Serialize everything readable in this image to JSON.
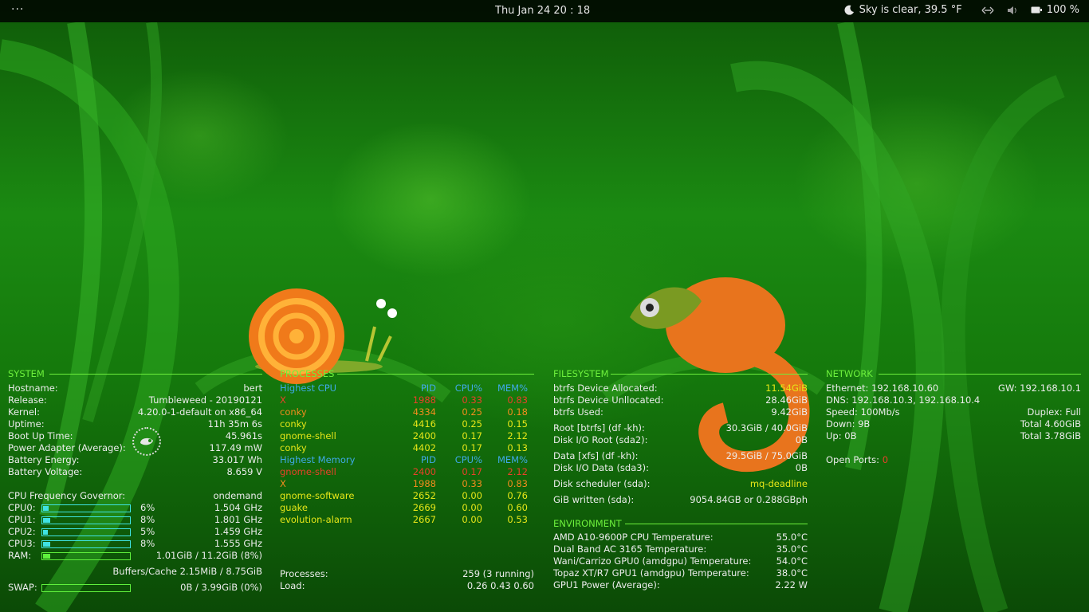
{
  "topbar": {
    "activities": "···",
    "clock": "Thu Jan 24  20 : 18",
    "weather": "Sky is clear, 39.5 °F",
    "battery": "100 %",
    "icons": [
      "moon-icon",
      "network-icon",
      "volume-icon",
      "battery-icon"
    ]
  },
  "system": {
    "title": "SYSTEM",
    "rows": [
      {
        "label": "Hostname:",
        "value": "bert"
      },
      {
        "label": "Release:",
        "value": "Tumbleweed - 20190121"
      },
      {
        "label": "Kernel:",
        "value": "4.20.0-1-default on x86_64"
      },
      {
        "label": "Uptime:",
        "value": "11h 35m 6s"
      },
      {
        "label": "Boot Up Time:",
        "value": "45.961s"
      },
      {
        "label": "Power Adapter (Average):",
        "value": "117.49 mW"
      },
      {
        "label": "Battery Energy:",
        "value": "33.017 Wh"
      },
      {
        "label": "Battery Voltage:",
        "value": "8.659 V"
      }
    ],
    "governor_label": "CPU Frequency Governor:",
    "governor_value": "ondemand",
    "cpus": [
      {
        "label": "CPU0:",
        "pct": "6%",
        "level": 0.06,
        "freq": "1.504 GHz"
      },
      {
        "label": "CPU1:",
        "pct": "8%",
        "level": 0.08,
        "freq": "1.801 GHz"
      },
      {
        "label": "CPU2:",
        "pct": "5%",
        "level": 0.05,
        "freq": "1.459 GHz"
      },
      {
        "label": "CPU3:",
        "pct": "8%",
        "level": 0.08,
        "freq": "1.555 GHz"
      }
    ],
    "ram_label": "RAM:",
    "ram_value": "1.01GiB / 11.2GiB (8%)",
    "ram_level": 0.08,
    "buffers": "Buffers/Cache 2.15MiB / 8.75GiB",
    "swap_label": "SWAP:",
    "swap_value": "0B   / 3.99GiB (0%)",
    "swap_level": 0
  },
  "processes": {
    "title": "PROCESSES",
    "cpu_header": {
      "name": "Highest CPU",
      "pid": "PID",
      "cpu": "CPU%",
      "mem": "MEM%"
    },
    "cpu_rows": [
      {
        "name": "X",
        "pid": "1988",
        "cpu": "0.33",
        "mem": "0.83"
      },
      {
        "name": "conky",
        "pid": "4334",
        "cpu": "0.25",
        "mem": "0.18"
      },
      {
        "name": "conky",
        "pid": "4416",
        "cpu": "0.25",
        "mem": "0.15"
      },
      {
        "name": "gnome-shell",
        "pid": "2400",
        "cpu": "0.17",
        "mem": "2.12"
      },
      {
        "name": "conky",
        "pid": "4402",
        "cpu": "0.17",
        "mem": "0.13"
      }
    ],
    "mem_header": {
      "name": "Highest Memory",
      "pid": "PID",
      "cpu": "CPU%",
      "mem": "MEM%"
    },
    "mem_rows": [
      {
        "name": "gnome-shell",
        "pid": "2400",
        "cpu": "0.17",
        "mem": "2.12"
      },
      {
        "name": "X",
        "pid": "1988",
        "cpu": "0.33",
        "mem": "0.83"
      },
      {
        "name": "gnome-software",
        "pid": "2652",
        "cpu": "0.00",
        "mem": "0.76"
      },
      {
        "name": "guake",
        "pid": "2669",
        "cpu": "0.00",
        "mem": "0.60"
      },
      {
        "name": "evolution-alarm",
        "pid": "2667",
        "cpu": "0.00",
        "mem": "0.53"
      }
    ],
    "processes_label": "Processes:",
    "processes_value": "259 (3 running)",
    "load_label": "Load:",
    "load_value": "0.26 0.43 0.60"
  },
  "filesystem": {
    "title": "FILESYSTEM",
    "allocated_label": "btrfs Device Allocated:",
    "allocated_value": "11.54GiB",
    "unallocated_label": "btrfs Device Unllocated:",
    "unallocated_value": "28.46GiB",
    "used_label": "btrfs Used:",
    "used_value": "9.42GiB",
    "root_label": "Root [btrfs] (df -kh):",
    "root_value": "30.3GiB / 40.0GiB",
    "rootio_label": "Disk I/O Root (sda2):",
    "rootio_value": "0B",
    "data_label": "Data [xfs] (df -kh):",
    "data_value": "29.5GiB / 75.0GiB",
    "dataio_label": "Disk I/O Data (sda3):",
    "dataio_value": "0B",
    "sched_label": "Disk scheduler (sda):",
    "sched_value": "mq-deadline",
    "written_label": "GiB written (sda):",
    "written_value": "9054.84GB or 0.288GBph"
  },
  "environment": {
    "title": "ENVIRONMENT",
    "rows": [
      {
        "label": "AMD A10-9600P CPU Temperature:",
        "value": "55.0°C"
      },
      {
        "label": "Dual Band AC 3165 Temperature:",
        "value": "35.0°C"
      },
      {
        "label": "Wani/Carrizo GPU0 (amdgpu) Temperature:",
        "value": "54.0°C"
      },
      {
        "label": "Topaz XT/R7 GPU1 (amdgpu) Temperature:",
        "value": "38.0°C"
      },
      {
        "label": "GPU1 Power (Average):",
        "value": "2.22 W"
      }
    ]
  },
  "network": {
    "title": "NETWORK",
    "ethernet": "Ethernet: 192.168.10.60",
    "gw": "GW: 192.168.10.1",
    "dns": "DNS: 192.168.10.3, 192.168.10.4",
    "speed": "Speed: 100Mb/s",
    "duplex": "Duplex: Full",
    "down": "Down: 9B",
    "total_down": "Total 4.60GiB",
    "up": "Up: 0B",
    "total_up": "Total 3.78GiB",
    "ports_label": "Open Ports:",
    "ports_value": "0"
  },
  "colors": {
    "accent": "#6df03c",
    "subheader": "#3fa9e8",
    "highlight_red": "#e8412a",
    "highlight_orange": "#f28c1e",
    "highlight_yellow": "#e6e618",
    "bar": "#3fe3e3"
  }
}
